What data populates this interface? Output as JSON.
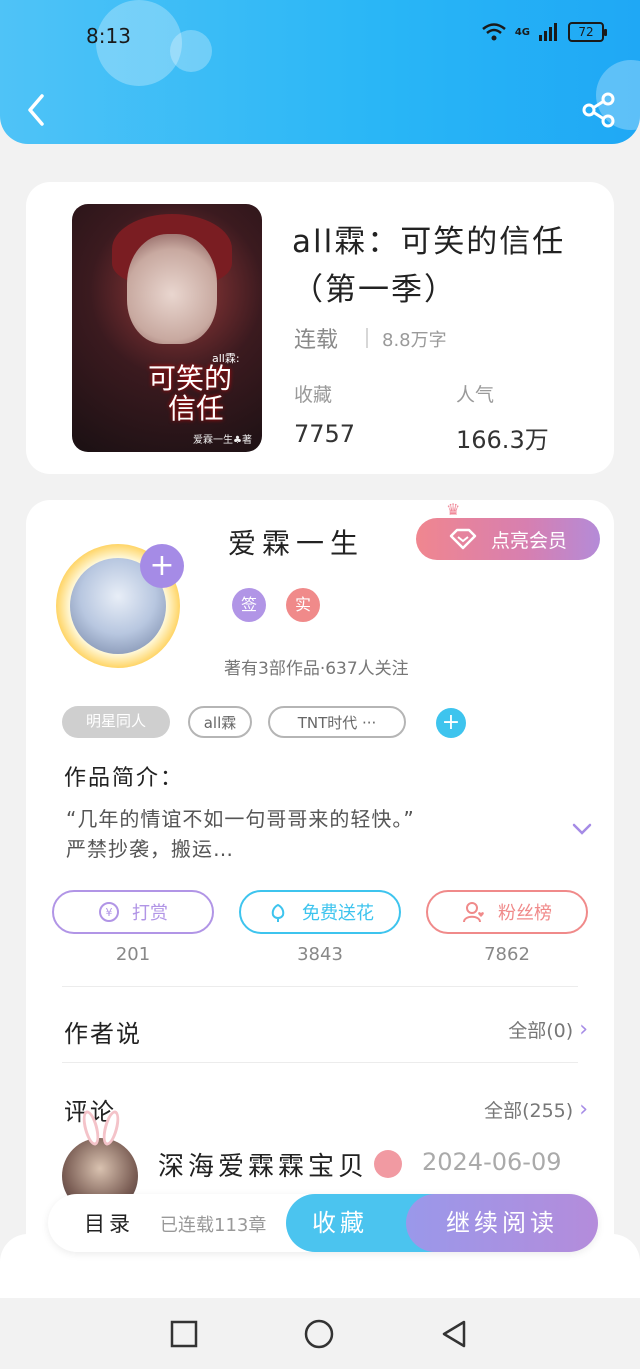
{
  "status_bar": {
    "time": "8:13",
    "network": "4G",
    "battery": "72"
  },
  "header": {
    "back_icon": "back-arrow-icon",
    "share_icon": "share-icon"
  },
  "book": {
    "title": "all霖：可笑的信任（第一季）",
    "status": "连载",
    "words": "8.8万字",
    "collect_label": "收藏",
    "collect_value": "7757",
    "popularity_label": "人气",
    "popularity_value": "166.3万",
    "cover": {
      "small": "all霖:",
      "title_line1": "可笑的",
      "title_line2": "信任",
      "author": "爱霖一生♣著"
    }
  },
  "author": {
    "name": "爱霖一生",
    "vip_button": "点亮会员",
    "badges": [
      {
        "text": "签",
        "color": "#b195e6"
      },
      {
        "text": "实",
        "color": "#f08a8a"
      }
    ],
    "works_info": "著有3部作品·637人关注",
    "follow_plus": "+"
  },
  "tags": [
    {
      "label": "明星同人",
      "style": "fill"
    },
    {
      "label": "all霖",
      "style": "line"
    },
    {
      "label": "TNT时代 ···",
      "style": "line"
    }
  ],
  "intro": {
    "title": "作品简介：",
    "line1": "“几年的情谊不如一句哥哥来的轻快。”",
    "line2": "严禁抄袭，搬运…"
  },
  "actions": [
    {
      "label": "打赏",
      "count": "201",
      "color": "#b195e6",
      "icon": "yen-icon"
    },
    {
      "label": "免费送花",
      "count": "3843",
      "color": "#3ec4ee",
      "icon": "flower-icon"
    },
    {
      "label": "粉丝榜",
      "count": "7862",
      "color": "#f08a8a",
      "icon": "fans-icon"
    }
  ],
  "author_says": {
    "title": "作者说",
    "all": "全部(0)"
  },
  "comments": {
    "title": "评论",
    "all": "全部(255)",
    "first": {
      "user": "深海爱霖霖宝贝",
      "date": "2024-06-09"
    }
  },
  "bottom_bar": {
    "catalog": "目录",
    "chapters": "已连载113章",
    "collect": "收藏",
    "continue": "继续阅读"
  },
  "colors": {
    "accent_blue": "#29b6f6",
    "accent_purple": "#a58be6",
    "accent_pink": "#f08a8a"
  }
}
